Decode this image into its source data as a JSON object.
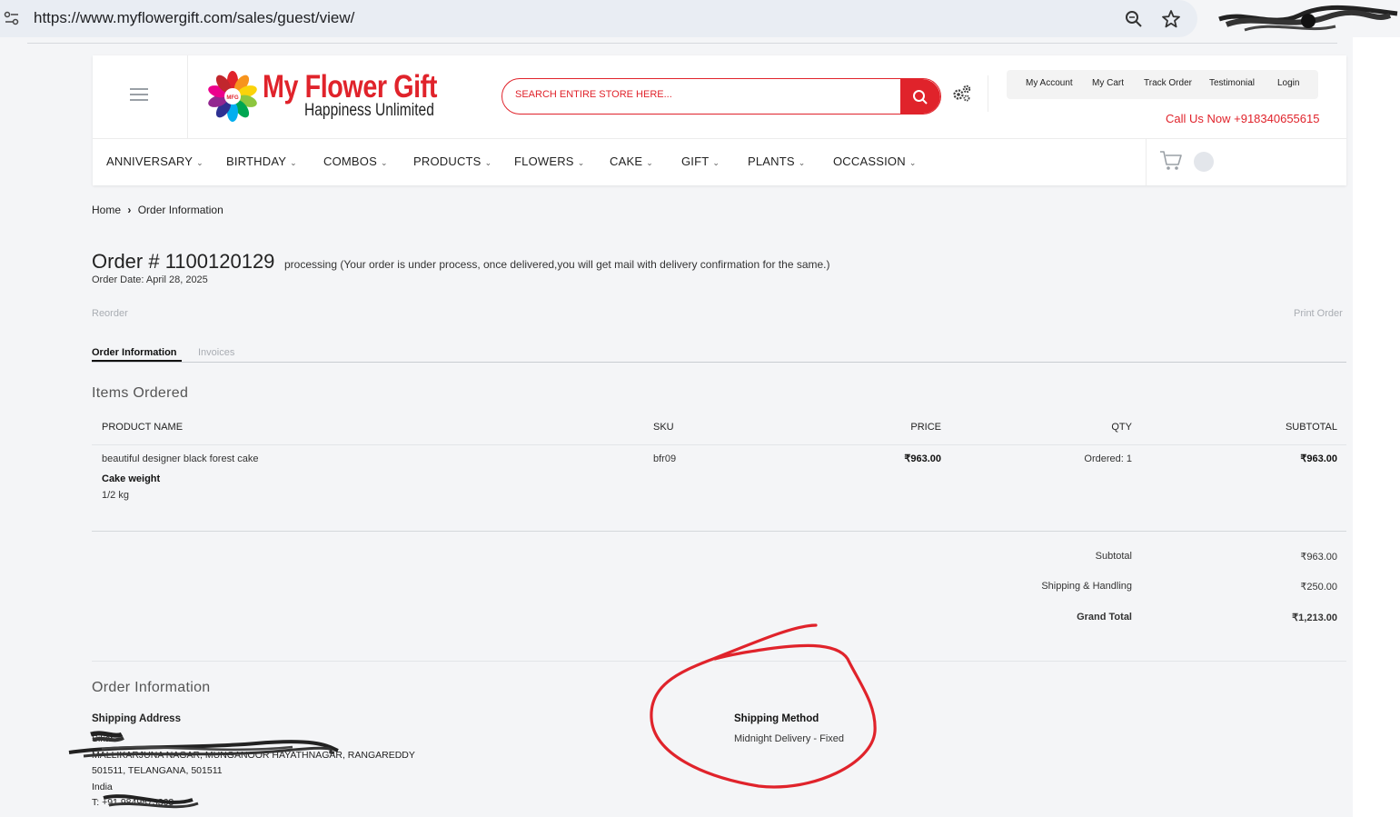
{
  "browser": {
    "url": "https://www.myflowergift.com/sales/guest/view/"
  },
  "header": {
    "logo_title": "My Flower Gift",
    "logo_subtitle": "Happiness Unlimited",
    "logo_badge": "MFG",
    "search_placeholder": "SEARCH ENTIRE STORE HERE...",
    "top_links": [
      "My Account",
      "My Cart",
      "Track Order",
      "Testimonial",
      "Login"
    ],
    "call_now": "Call Us Now +918340655615",
    "nav": [
      "ANNIVERSARY",
      "BIRTHDAY",
      "COMBOS",
      "PRODUCTS",
      "FLOWERS",
      "CAKE",
      "GIFT",
      "PLANTS",
      "OCCASSION"
    ]
  },
  "breadcrumb": {
    "home": "Home",
    "current": "Order Information"
  },
  "order": {
    "title": "Order # 1100120129",
    "status": "processing (Your order is under process, once delivered,you will get mail with delivery confirmation for the same.)",
    "date": "Order Date: April 28, 2025",
    "reorder": "Reorder",
    "print": "Print Order"
  },
  "tabs": {
    "active": "Order Information",
    "inactive": "Invoices"
  },
  "items": {
    "section_title": "Items Ordered",
    "headers": [
      "PRODUCT NAME",
      "SKU",
      "PRICE",
      "QTY",
      "SUBTOTAL"
    ],
    "rows": [
      {
        "name": "beautiful designer black forest cake",
        "option_label": "Cake weight",
        "option_value": "1/2 kg",
        "sku": "bfr09",
        "price": "₹963.00",
        "qty": "Ordered: 1",
        "subtotal": "₹963.00"
      }
    ]
  },
  "totals": {
    "subtotal_label": "Subtotal",
    "subtotal": "₹963.00",
    "shipping_label": "Shipping & Handling",
    "shipping": "₹250.00",
    "grand_label": "Grand Total",
    "grand": "₹1,213.00"
  },
  "order_info": {
    "section_title": "Order Information",
    "shipping_address_label": "Shipping Address",
    "address_name": "Sikar .",
    "address_line1": "MALLIKARJUNA NAGAR, MUNGANOOR HAYATHNAGAR, RANGAREDDY",
    "address_line2": "501511, TELANGANA, 501511",
    "address_country": "India",
    "address_phone": "T: +91 9849873363",
    "shipping_method_label": "Shipping Method",
    "shipping_method": "Midnight Delivery - Fixed"
  },
  "annotation_color": "#e0232b",
  "brand_color": "#e0232b"
}
